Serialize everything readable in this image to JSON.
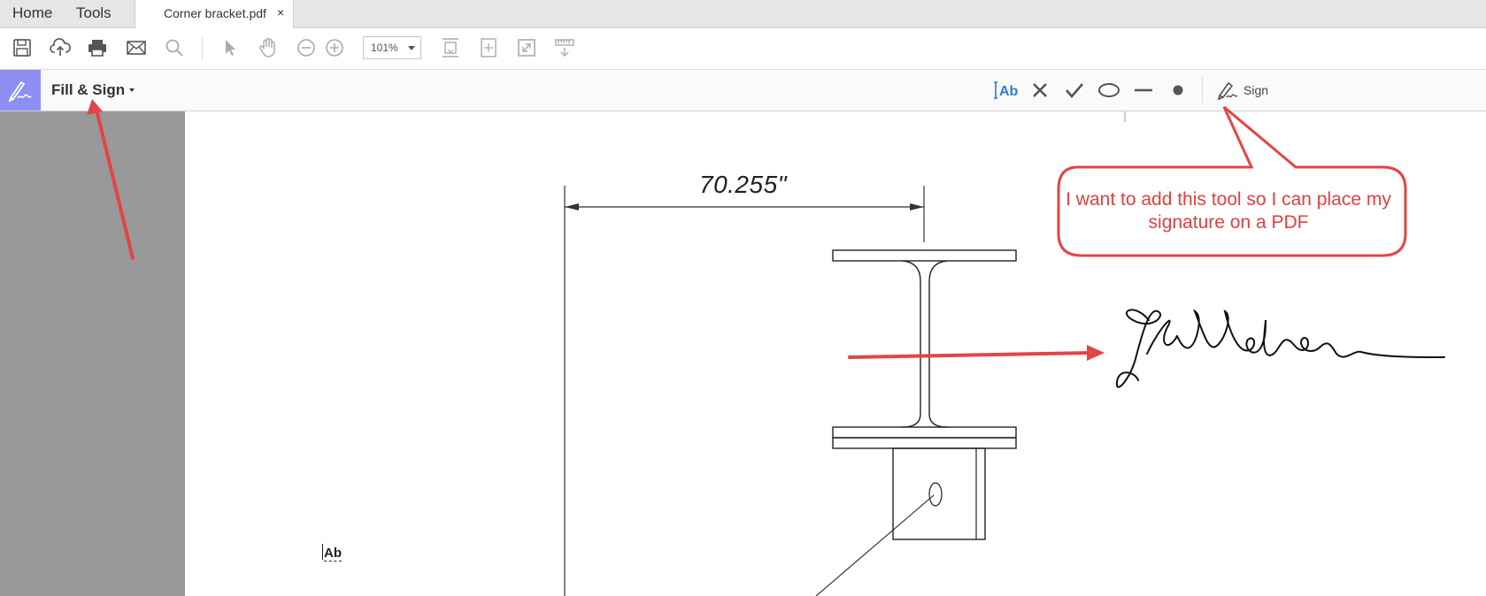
{
  "nav": {
    "home": "Home",
    "tools": "Tools"
  },
  "document_tab": {
    "title": "Corner bracket.pdf",
    "close": "×"
  },
  "toolbar": {
    "zoom": "101%",
    "icons": [
      "save-icon",
      "upload-cloud-icon",
      "print-icon",
      "email-icon",
      "search-icon",
      "select-arrow-icon",
      "hand-pan-icon",
      "zoom-out-icon",
      "zoom-in-icon",
      "fit-width-icon",
      "fit-page-icon",
      "full-screen-icon",
      "read-mode-icon"
    ]
  },
  "fill_sign": {
    "title": "Fill & Sign",
    "tools": [
      "add-text-icon",
      "cross-mark-icon",
      "check-mark-icon",
      "ellipse-icon",
      "line-icon",
      "dot-icon"
    ],
    "add_text_label": "Ab",
    "sign_label": "Sign",
    "accent": "#8e8ff5"
  },
  "drawing": {
    "dimension": "70.255\""
  },
  "annotation": {
    "callout": "I want to add this tool so I can place my signature on a PDF",
    "color": "#e0403f"
  },
  "page": {
    "text_field_label": "Ab"
  }
}
